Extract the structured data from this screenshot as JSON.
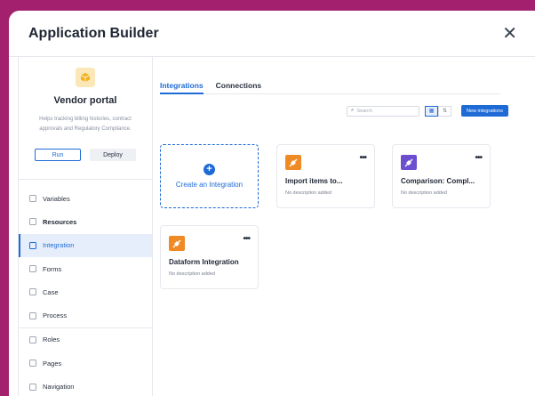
{
  "window": {
    "title": "Application Builder"
  },
  "app": {
    "name": "Vendor portal",
    "description": "Helps tracking billing histories, contract approvals and Regulatory Compliance.",
    "run_label": "Run",
    "deploy_label": "Deploy"
  },
  "sidebar": {
    "items": [
      {
        "label": "Variables",
        "icon": "variables-icon"
      },
      {
        "label": "Resources",
        "icon": "folder-icon"
      },
      {
        "label": "Integration",
        "icon": "integration-icon"
      },
      {
        "label": "Forms",
        "icon": "form-icon"
      },
      {
        "label": "Case",
        "icon": "case-icon"
      },
      {
        "label": "Process",
        "icon": "process-icon"
      },
      {
        "label": "Roles",
        "icon": "user-icon"
      },
      {
        "label": "Pages",
        "icon": "page-icon"
      },
      {
        "label": "Navigation",
        "icon": "navigation-icon"
      }
    ]
  },
  "tabs": [
    {
      "label": "Integrations"
    },
    {
      "label": "Connections"
    }
  ],
  "toolbar": {
    "search_placeholder": "Search",
    "new_label": "New integrations"
  },
  "create_card": {
    "label": "Create an Integration"
  },
  "cards": [
    {
      "title": "Import items to...",
      "description": "No description added",
      "icon_color": "#f08a24"
    },
    {
      "title": "Comparison: Compl...",
      "description": "No description added",
      "icon_color": "#6b4fcf"
    },
    {
      "title": "Dataform Integration",
      "description": "No description added",
      "icon_color": "#f08a24"
    }
  ],
  "colors": {
    "accent": "#1e6bd6",
    "frame": "#a3206f"
  }
}
